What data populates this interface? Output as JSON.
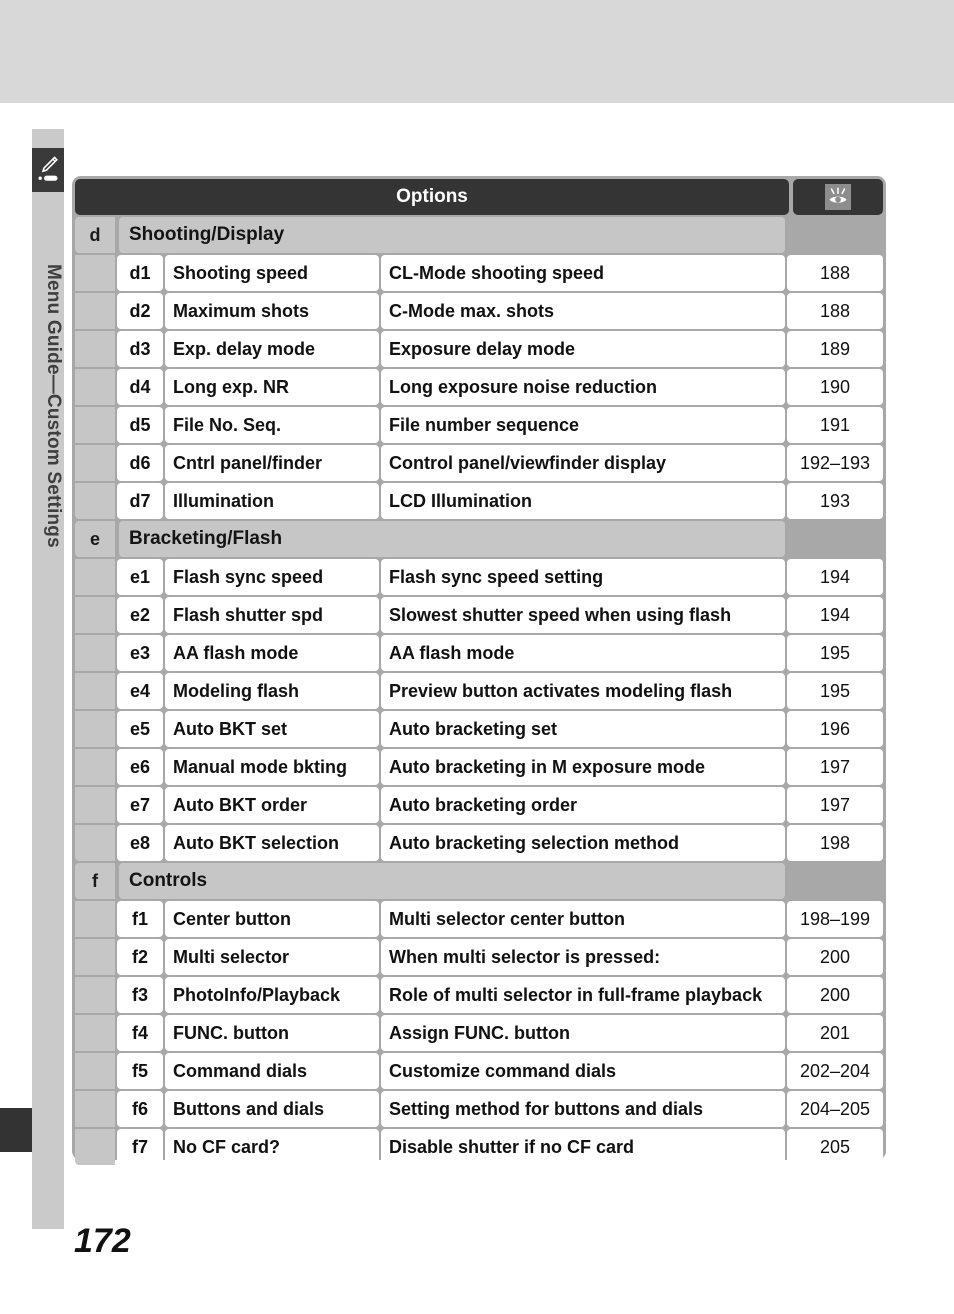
{
  "page": {
    "number": "172",
    "sidebar_label": "Menu Guide—Custom Settings",
    "sidebar_icon": "pencil-icon",
    "top_band_color": "#d8d8d8",
    "sidebar_color": "#cacaca"
  },
  "table": {
    "header": {
      "title": "Options",
      "icon": "eye-with-rays-icon"
    },
    "columns": [
      "group",
      "code",
      "name",
      "description",
      "page"
    ],
    "groups": [
      {
        "letter": "d",
        "title": "Shooting/Display",
        "rows": [
          {
            "code": "d1",
            "name": "Shooting speed",
            "description": "CL-Mode shooting speed",
            "page": "188"
          },
          {
            "code": "d2",
            "name": "Maximum shots",
            "description": "C-Mode max. shots",
            "page": "188"
          },
          {
            "code": "d3",
            "name": "Exp. delay mode",
            "description": "Exposure delay mode",
            "page": "189"
          },
          {
            "code": "d4",
            "name": "Long exp. NR",
            "description": "Long exposure noise reduction",
            "page": "190"
          },
          {
            "code": "d5",
            "name": "File No. Seq.",
            "description": "File number sequence",
            "page": "191"
          },
          {
            "code": "d6",
            "name": "Cntrl panel/finder",
            "description": "Control panel/viewfinder display",
            "page": "192–193"
          },
          {
            "code": "d7",
            "name": "Illumination",
            "description": "LCD Illumination",
            "page": "193"
          }
        ]
      },
      {
        "letter": "e",
        "title": "Bracketing/Flash",
        "rows": [
          {
            "code": "e1",
            "name": "Flash sync speed",
            "description": "Flash sync speed setting",
            "page": "194"
          },
          {
            "code": "e2",
            "name": "Flash shutter spd",
            "description": "Slowest shutter speed when using flash",
            "page": "194"
          },
          {
            "code": "e3",
            "name": "AA flash mode",
            "description": "AA flash mode",
            "page": "195"
          },
          {
            "code": "e4",
            "name": "Modeling flash",
            "description": "Preview button activates modeling flash",
            "page": "195"
          },
          {
            "code": "e5",
            "name": "Auto BKT set",
            "description": "Auto bracketing set",
            "page": "196"
          },
          {
            "code": "e6",
            "name": "Manual mode bkting",
            "description": "Auto bracketing in M exposure mode",
            "page": "197"
          },
          {
            "code": "e7",
            "name": "Auto BKT order",
            "description": "Auto bracketing order",
            "page": "197"
          },
          {
            "code": "e8",
            "name": "Auto BKT selection",
            "description": "Auto bracketing selection method",
            "page": "198"
          }
        ]
      },
      {
        "letter": "f",
        "title": "Controls",
        "rows": [
          {
            "code": "f1",
            "name": "Center button",
            "description": "Multi selector center button",
            "page": "198–199"
          },
          {
            "code": "f2",
            "name": "Multi selector",
            "description": "When multi selector is pressed:",
            "page": "200"
          },
          {
            "code": "f3",
            "name": "PhotoInfo/Playback",
            "description": "Role of multi selector in full-frame playback",
            "page": "200"
          },
          {
            "code": "f4",
            "name": "FUNC. button",
            "description": "Assign FUNC. button",
            "page": "201"
          },
          {
            "code": "f5",
            "name": "Command dials",
            "description": "Customize command dials",
            "page": "202–204"
          },
          {
            "code": "f6",
            "name": "Buttons and dials",
            "description": "Setting method for buttons and dials",
            "page": "204–205"
          },
          {
            "code": "f7",
            "name": "No CF card?",
            "description": "Disable shutter if no CF card",
            "page": "205"
          }
        ]
      }
    ]
  }
}
